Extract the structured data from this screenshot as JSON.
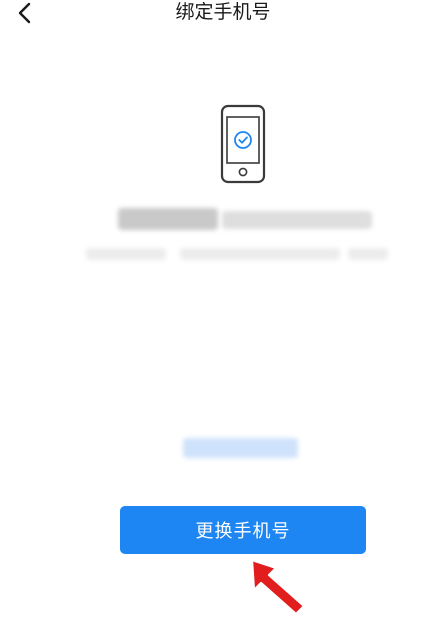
{
  "header": {
    "back_icon": "chevron-left-icon",
    "title": "绑定手机号"
  },
  "hero": {
    "icon": "phone-check-icon"
  },
  "actions": {
    "change_phone_label": "更换手机号"
  },
  "annotation": {
    "icon": "red-arrow-icon"
  },
  "colors": {
    "primary": "#1d86f2",
    "annotation": "#e11d1d"
  }
}
